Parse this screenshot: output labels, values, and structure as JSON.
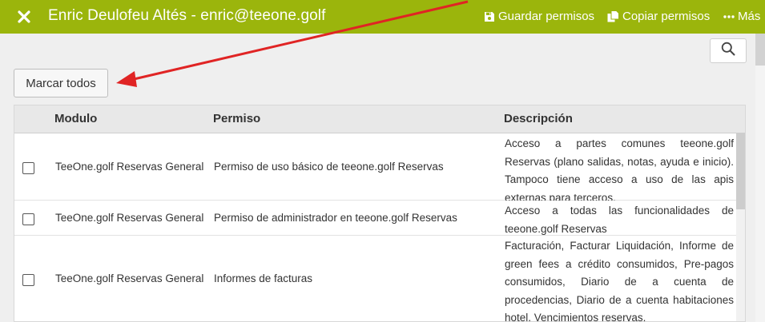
{
  "header": {
    "title": "Enric Deulofeu Altés - enric@teeone.golf",
    "actions": {
      "save_label": "Guardar permisos",
      "copy_label": "Copiar permisos",
      "more_label": "Más"
    }
  },
  "toolbar": {
    "mark_all_label": "Marcar todos"
  },
  "table": {
    "columns": {
      "module": "Modulo",
      "permission": "Permiso",
      "description": "Descripción"
    },
    "rows": [
      {
        "module": "TeeOne.golf Reservas General",
        "permission": "Permiso de uso básico de teeone.golf Reservas",
        "description": "Acceso a partes comunes teeone.golf Reservas (plano salidas, notas, ayuda e inicio). Tampoco tiene acceso a uso de las apis externas para terceros.",
        "checked": false
      },
      {
        "module": "TeeOne.golf Reservas General",
        "permission": "Permiso de administrador en teeone.golf Reservas",
        "description": "Acceso a todas las funcionalidades de teeone.golf Reservas",
        "checked": false
      },
      {
        "module": "TeeOne.golf Reservas General",
        "permission": "Informes de facturas",
        "description": "Facturación, Facturar Liquidación, Informe de green fees a crédito consumidos, Pre-pagos consumidos, Diario de a cuenta de procedencias, Diario de a cuenta habitaciones hotel, Vencimientos reservas.",
        "checked": false
      }
    ]
  },
  "colors": {
    "header_bg": "#9bb50c",
    "annotation_arrow": "#e02424"
  }
}
